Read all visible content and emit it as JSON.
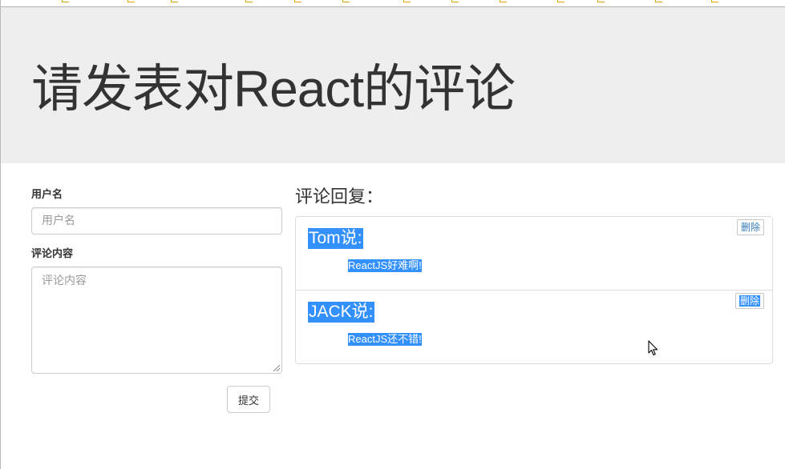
{
  "header": {
    "title": "请发表对React的评论"
  },
  "form": {
    "username_label": "用户名",
    "username_placeholder": "用户名",
    "username_value": "",
    "content_label": "评论内容",
    "content_placeholder": "评论内容",
    "content_value": "",
    "submit_label": "提交"
  },
  "comments": {
    "title": "评论回复：",
    "items": [
      {
        "author": "Tom说:",
        "content": "ReactJS好难啊!",
        "delete_label": "删除"
      },
      {
        "author": "JACK说:",
        "content": "ReactJS还不错!",
        "delete_label": "删除"
      }
    ]
  },
  "colors": {
    "jumbotron_bg": "#eeeeee",
    "selection": "#3390ff",
    "link": "#337ab7",
    "border": "#dddddd"
  },
  "icons": [
    "mouse-pointer-icon",
    "resize-grip-icon"
  ]
}
